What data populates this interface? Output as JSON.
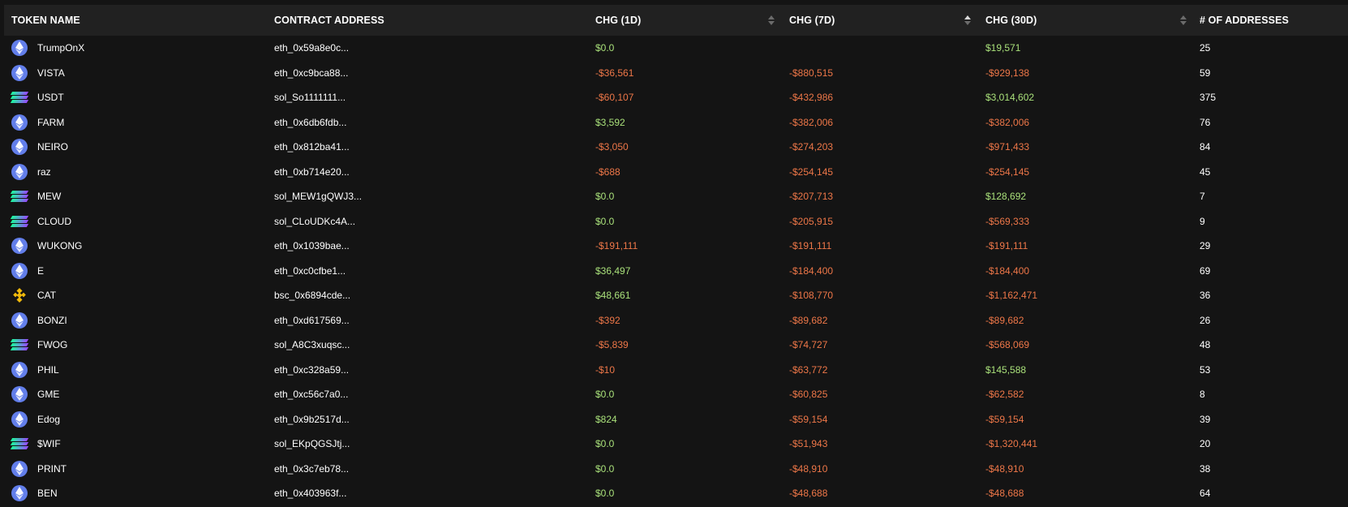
{
  "colors": {
    "background": "#141414",
    "header_background": "#212121",
    "positive": "#a9e07a",
    "negative": "#ee7748",
    "eth_icon": "#627eea"
  },
  "header": {
    "token_name": "TOKEN NAME",
    "contract_address": "CONTRACT ADDRESS",
    "chg_1d": "CHG (1D)",
    "chg_7d": "CHG (7D)",
    "chg_30d": "CHG (30D)",
    "num_addresses": "# OF ADDRESSES"
  },
  "rows": [
    {
      "icon": "eth-icon",
      "name": "TrumpOnX",
      "address": "eth_0x59a8e0c...",
      "chg_1d": "$0.0",
      "chg_7d": "",
      "chg_30d": "$19,571",
      "addresses": "25"
    },
    {
      "icon": "eth-icon",
      "name": "VISTA",
      "address": "eth_0xc9bca88...",
      "chg_1d": "-$36,561",
      "chg_7d": "-$880,515",
      "chg_30d": "-$929,138",
      "addresses": "59"
    },
    {
      "icon": "sol-icon",
      "name": "USDT",
      "address": "sol_So1111111...",
      "chg_1d": "-$60,107",
      "chg_7d": "-$432,986",
      "chg_30d": "$3,014,602",
      "addresses": "375"
    },
    {
      "icon": "eth-icon",
      "name": "FARM",
      "address": "eth_0x6db6fdb...",
      "chg_1d": "$3,592",
      "chg_7d": "-$382,006",
      "chg_30d": "-$382,006",
      "addresses": "76"
    },
    {
      "icon": "eth-icon",
      "name": "NEIRO",
      "address": "eth_0x812ba41...",
      "chg_1d": "-$3,050",
      "chg_7d": "-$274,203",
      "chg_30d": "-$971,433",
      "addresses": "84"
    },
    {
      "icon": "eth-icon",
      "name": "raz",
      "address": "eth_0xb714e20...",
      "chg_1d": "-$688",
      "chg_7d": "-$254,145",
      "chg_30d": "-$254,145",
      "addresses": "45"
    },
    {
      "icon": "sol-icon",
      "name": "MEW",
      "address": "sol_MEW1gQWJ3...",
      "chg_1d": "$0.0",
      "chg_7d": "-$207,713",
      "chg_30d": "$128,692",
      "addresses": "7"
    },
    {
      "icon": "sol-icon",
      "name": "CLOUD",
      "address": "sol_CLoUDKc4A...",
      "chg_1d": "$0.0",
      "chg_7d": "-$205,915",
      "chg_30d": "-$569,333",
      "addresses": "9"
    },
    {
      "icon": "eth-icon",
      "name": "WUKONG",
      "address": "eth_0x1039bae...",
      "chg_1d": "-$191,111",
      "chg_7d": "-$191,111",
      "chg_30d": "-$191,111",
      "addresses": "29"
    },
    {
      "icon": "eth-icon",
      "name": "E",
      "address": "eth_0xc0cfbe1...",
      "chg_1d": "$36,497",
      "chg_7d": "-$184,400",
      "chg_30d": "-$184,400",
      "addresses": "69"
    },
    {
      "icon": "bsc-icon",
      "name": "CAT",
      "address": "bsc_0x6894cde...",
      "chg_1d": "$48,661",
      "chg_7d": "-$108,770",
      "chg_30d": "-$1,162,471",
      "addresses": "36"
    },
    {
      "icon": "eth-icon",
      "name": "BONZI",
      "address": "eth_0xd617569...",
      "chg_1d": "-$392",
      "chg_7d": "-$89,682",
      "chg_30d": "-$89,682",
      "addresses": "26"
    },
    {
      "icon": "sol-icon",
      "name": "FWOG",
      "address": "sol_A8C3xuqsc...",
      "chg_1d": "-$5,839",
      "chg_7d": "-$74,727",
      "chg_30d": "-$568,069",
      "addresses": "48"
    },
    {
      "icon": "eth-icon",
      "name": "PHIL",
      "address": "eth_0xc328a59...",
      "chg_1d": "-$10",
      "chg_7d": "-$63,772",
      "chg_30d": "$145,588",
      "addresses": "53"
    },
    {
      "icon": "eth-icon",
      "name": "GME",
      "address": "eth_0xc56c7a0...",
      "chg_1d": "$0.0",
      "chg_7d": "-$60,825",
      "chg_30d": "-$62,582",
      "addresses": "8"
    },
    {
      "icon": "eth-icon",
      "name": "Edog",
      "address": "eth_0x9b2517d...",
      "chg_1d": "$824",
      "chg_7d": "-$59,154",
      "chg_30d": "-$59,154",
      "addresses": "39"
    },
    {
      "icon": "sol-icon",
      "name": "$WIF",
      "address": "sol_EKpQGSJtj...",
      "chg_1d": "$0.0",
      "chg_7d": "-$51,943",
      "chg_30d": "-$1,320,441",
      "addresses": "20"
    },
    {
      "icon": "eth-icon",
      "name": "PRINT",
      "address": "eth_0x3c7eb78...",
      "chg_1d": "$0.0",
      "chg_7d": "-$48,910",
      "chg_30d": "-$48,910",
      "addresses": "38"
    },
    {
      "icon": "eth-icon",
      "name": "BEN",
      "address": "eth_0x403963f...",
      "chg_1d": "$0.0",
      "chg_7d": "-$48,688",
      "chg_30d": "-$48,688",
      "addresses": "64"
    }
  ]
}
